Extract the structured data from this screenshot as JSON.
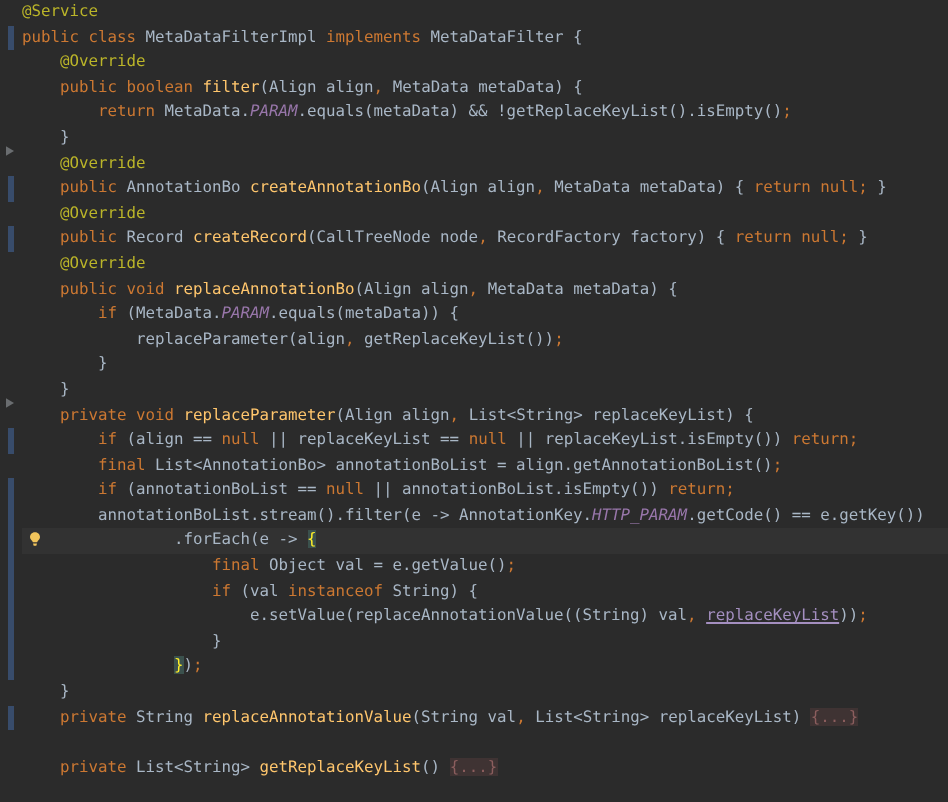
{
  "editor": {
    "lines": [
      {
        "tokens": [
          {
            "kind": "annotation",
            "text": "@Service"
          }
        ],
        "changed": false,
        "fold": false,
        "current": false
      },
      {
        "tokens": [
          {
            "kind": "keyword",
            "text": "public class "
          },
          {
            "kind": "plain",
            "text": "MetaDataFilterImpl "
          },
          {
            "kind": "keyword",
            "text": "implements "
          },
          {
            "kind": "plain",
            "text": "MetaDataFilter {"
          }
        ],
        "changed": true,
        "fold": false,
        "current": false
      },
      {
        "tokens": [
          {
            "kind": "annotation",
            "text": "    @Override"
          }
        ],
        "changed": false,
        "fold": false,
        "current": false
      },
      {
        "tokens": [
          {
            "kind": "keyword",
            "text": "    public boolean "
          },
          {
            "kind": "declaration",
            "text": "filter"
          },
          {
            "kind": "plain",
            "text": "(Align align"
          },
          {
            "kind": "keyword",
            "text": ", "
          },
          {
            "kind": "plain",
            "text": "MetaData metaData) {"
          }
        ],
        "changed": false,
        "fold": false,
        "current": false
      },
      {
        "tokens": [
          {
            "kind": "keyword",
            "text": "        return "
          },
          {
            "kind": "plain",
            "text": "MetaData."
          },
          {
            "kind": "constant",
            "text": "PARAM"
          },
          {
            "kind": "plain",
            "text": ".equals(metaData) && !getReplaceKeyList().isEmpty()"
          },
          {
            "kind": "keyword",
            "text": ";"
          }
        ],
        "changed": false,
        "fold": false,
        "current": false
      },
      {
        "tokens": [
          {
            "kind": "plain",
            "text": "    }"
          }
        ],
        "changed": false,
        "fold": false,
        "current": false
      },
      {
        "tokens": [
          {
            "kind": "annotation",
            "text": "    @Override"
          }
        ],
        "changed": false,
        "fold": true,
        "current": false
      },
      {
        "tokens": [
          {
            "kind": "keyword",
            "text": "    public "
          },
          {
            "kind": "plain",
            "text": "AnnotationBo "
          },
          {
            "kind": "declaration",
            "text": "createAnnotationBo"
          },
          {
            "kind": "plain",
            "text": "(Align align"
          },
          {
            "kind": "keyword",
            "text": ", "
          },
          {
            "kind": "plain",
            "text": "MetaData metaData) { "
          },
          {
            "kind": "keyword",
            "text": "return null; "
          },
          {
            "kind": "plain",
            "text": "}"
          }
        ],
        "changed": true,
        "fold": false,
        "current": false
      },
      {
        "tokens": [
          {
            "kind": "annotation",
            "text": "    @Override"
          }
        ],
        "changed": false,
        "fold": false,
        "current": false
      },
      {
        "tokens": [
          {
            "kind": "keyword",
            "text": "    public "
          },
          {
            "kind": "plain",
            "text": "Record "
          },
          {
            "kind": "declaration",
            "text": "createRecord"
          },
          {
            "kind": "plain",
            "text": "(CallTreeNode node"
          },
          {
            "kind": "keyword",
            "text": ", "
          },
          {
            "kind": "plain",
            "text": "RecordFactory factory) { "
          },
          {
            "kind": "keyword",
            "text": "return null; "
          },
          {
            "kind": "plain",
            "text": "}"
          }
        ],
        "changed": true,
        "fold": false,
        "current": false
      },
      {
        "tokens": [
          {
            "kind": "annotation",
            "text": "    @Override"
          }
        ],
        "changed": false,
        "fold": false,
        "current": false
      },
      {
        "tokens": [
          {
            "kind": "keyword",
            "text": "    public void "
          },
          {
            "kind": "declaration",
            "text": "replaceAnnotationBo"
          },
          {
            "kind": "plain",
            "text": "(Align align"
          },
          {
            "kind": "keyword",
            "text": ", "
          },
          {
            "kind": "plain",
            "text": "MetaData metaData) {"
          }
        ],
        "changed": false,
        "fold": false,
        "current": false
      },
      {
        "tokens": [
          {
            "kind": "keyword",
            "text": "        if "
          },
          {
            "kind": "plain",
            "text": "(MetaData."
          },
          {
            "kind": "constant",
            "text": "PARAM"
          },
          {
            "kind": "plain",
            "text": ".equals(metaData)) {"
          }
        ],
        "changed": false,
        "fold": false,
        "current": false
      },
      {
        "tokens": [
          {
            "kind": "plain",
            "text": "            replaceParameter(align"
          },
          {
            "kind": "keyword",
            "text": ", "
          },
          {
            "kind": "plain",
            "text": "getReplaceKeyList())"
          },
          {
            "kind": "keyword",
            "text": ";"
          }
        ],
        "changed": false,
        "fold": false,
        "current": false
      },
      {
        "tokens": [
          {
            "kind": "plain",
            "text": "        }"
          }
        ],
        "changed": false,
        "fold": false,
        "current": false
      },
      {
        "tokens": [
          {
            "kind": "plain",
            "text": "    }"
          }
        ],
        "changed": false,
        "fold": false,
        "current": false
      },
      {
        "tokens": [
          {
            "kind": "keyword",
            "text": "    private void "
          },
          {
            "kind": "declaration",
            "text": "replaceParameter"
          },
          {
            "kind": "plain",
            "text": "(Align align"
          },
          {
            "kind": "keyword",
            "text": ", "
          },
          {
            "kind": "plain",
            "text": "List<String> replaceKeyList) {"
          }
        ],
        "changed": false,
        "fold": true,
        "current": false
      },
      {
        "tokens": [
          {
            "kind": "keyword",
            "text": "        if "
          },
          {
            "kind": "plain",
            "text": "(align == "
          },
          {
            "kind": "keyword",
            "text": "null "
          },
          {
            "kind": "plain",
            "text": "|| replaceKeyList == "
          },
          {
            "kind": "keyword",
            "text": "null "
          },
          {
            "kind": "plain",
            "text": "|| replaceKeyList.isEmpty()) "
          },
          {
            "kind": "keyword",
            "text": "return;"
          }
        ],
        "changed": true,
        "fold": false,
        "current": false
      },
      {
        "tokens": [
          {
            "kind": "keyword",
            "text": "        final "
          },
          {
            "kind": "plain",
            "text": "List<AnnotationBo> annotationBoList = align.getAnnotationBoList()"
          },
          {
            "kind": "keyword",
            "text": ";"
          }
        ],
        "changed": false,
        "fold": false,
        "current": false
      },
      {
        "tokens": [
          {
            "kind": "keyword",
            "text": "        if "
          },
          {
            "kind": "plain",
            "text": "(annotationBoList == "
          },
          {
            "kind": "keyword",
            "text": "null "
          },
          {
            "kind": "plain",
            "text": "|| annotationBoList.isEmpty()) "
          },
          {
            "kind": "keyword",
            "text": "return;"
          }
        ],
        "changed": true,
        "fold": false,
        "current": false
      },
      {
        "tokens": [
          {
            "kind": "plain",
            "text": "        annotationBoList.stream().filter(e -> AnnotationKey."
          },
          {
            "kind": "constant",
            "text": "HTTP_PARAM"
          },
          {
            "kind": "plain",
            "text": ".getCode() == e.getKey())"
          }
        ],
        "changed": true,
        "fold": false,
        "current": false
      },
      {
        "tokens": [
          {
            "kind": "plain",
            "text": "                .forEach(e -> "
          },
          {
            "kind": "match",
            "text": "{"
          }
        ],
        "changed": true,
        "fold": false,
        "current": true
      },
      {
        "tokens": [
          {
            "kind": "keyword",
            "text": "                    final "
          },
          {
            "kind": "plain",
            "text": "Object val = e.getValue()"
          },
          {
            "kind": "keyword",
            "text": ";"
          }
        ],
        "changed": true,
        "fold": false,
        "current": false
      },
      {
        "tokens": [
          {
            "kind": "keyword",
            "text": "                    if "
          },
          {
            "kind": "plain",
            "text": "(val "
          },
          {
            "kind": "keyword",
            "text": "instanceof "
          },
          {
            "kind": "plain",
            "text": "String) {"
          }
        ],
        "changed": true,
        "fold": false,
        "current": false
      },
      {
        "tokens": [
          {
            "kind": "plain",
            "text": "                        e.setValue(replaceAnnotationValue((String) val"
          },
          {
            "kind": "keyword",
            "text": ", "
          },
          {
            "kind": "reference",
            "text": "replaceKeyList"
          },
          {
            "kind": "plain",
            "text": "))"
          },
          {
            "kind": "keyword",
            "text": ";"
          }
        ],
        "changed": true,
        "fold": false,
        "current": false
      },
      {
        "tokens": [
          {
            "kind": "plain",
            "text": "                    }"
          }
        ],
        "changed": true,
        "fold": false,
        "current": false
      },
      {
        "tokens": [
          {
            "kind": "match",
            "text": "                }"
          },
          {
            "kind": "plain",
            "text": ")"
          },
          {
            "kind": "keyword",
            "text": ";"
          }
        ],
        "changed": true,
        "fold": false,
        "current": false
      },
      {
        "tokens": [
          {
            "kind": "plain",
            "text": "    }"
          }
        ],
        "changed": false,
        "fold": false,
        "current": false
      },
      {
        "tokens": [
          {
            "kind": "keyword",
            "text": "    private "
          },
          {
            "kind": "plain",
            "text": "String "
          },
          {
            "kind": "declaration",
            "text": "replaceAnnotationValue"
          },
          {
            "kind": "plain",
            "text": "(String val"
          },
          {
            "kind": "keyword",
            "text": ", "
          },
          {
            "kind": "plain",
            "text": "List<String> replaceKeyList) "
          },
          {
            "kind": "folded",
            "text": "{...}"
          }
        ],
        "changed": true,
        "fold": false,
        "current": false
      },
      {
        "changed": false,
        "fold": false,
        "current": false
      },
      {
        "tokens": [
          {
            "kind": "keyword",
            "text": "    private "
          },
          {
            "kind": "plain",
            "text": "List<String> "
          },
          {
            "kind": "declaration",
            "text": "getReplaceKeyList"
          },
          {
            "kind": "plain",
            "text": "() "
          },
          {
            "kind": "folded",
            "text": "{...}"
          }
        ],
        "changed": false,
        "fold": false,
        "current": false
      }
    ]
  }
}
